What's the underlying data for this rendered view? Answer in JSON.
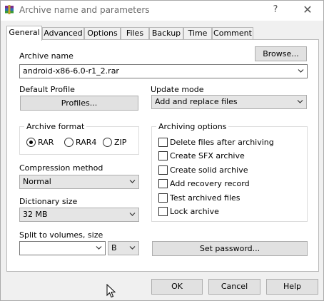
{
  "window": {
    "title": "Archive name and parameters",
    "help_glyph": "?",
    "close_glyph": "✕"
  },
  "tabs": [
    "General",
    "Advanced",
    "Options",
    "Files",
    "Backup",
    "Time",
    "Comment"
  ],
  "general": {
    "archive_name_label": "Archive name",
    "browse_label": "Browse...",
    "archive_name_value": "android-x86-6.0-r1_2.rar",
    "default_profile_label": "Default Profile",
    "profiles_label": "Profiles...",
    "update_mode_label": "Update mode",
    "update_mode_value": "Add and replace files",
    "archive_format": {
      "title": "Archive format",
      "options": [
        "RAR",
        "RAR4",
        "ZIP"
      ],
      "selected": "RAR"
    },
    "compression_method_label": "Compression method",
    "compression_method_value": "Normal",
    "dictionary_size_label": "Dictionary size",
    "dictionary_size_value": "32 MB",
    "split_label": "Split to volumes, size",
    "split_value": "",
    "split_unit": "B",
    "archiving_options": {
      "title": "Archiving options",
      "items": [
        {
          "label": "Delete files after archiving",
          "checked": false
        },
        {
          "label": "Create SFX archive",
          "checked": false
        },
        {
          "label": "Create solid archive",
          "checked": false
        },
        {
          "label": "Add recovery record",
          "checked": false
        },
        {
          "label": "Test archived files",
          "checked": false
        },
        {
          "label": "Lock archive",
          "checked": false
        }
      ]
    },
    "set_password_label": "Set password..."
  },
  "footer": {
    "ok_label": "OK",
    "cancel_label": "Cancel",
    "help_label": "Help"
  },
  "colors": {
    "title_text": "#6c6c6c",
    "button_face": "#e1e1e1",
    "panel_bg": "#ffffff",
    "dialog_bg": "#f0f0f0"
  }
}
